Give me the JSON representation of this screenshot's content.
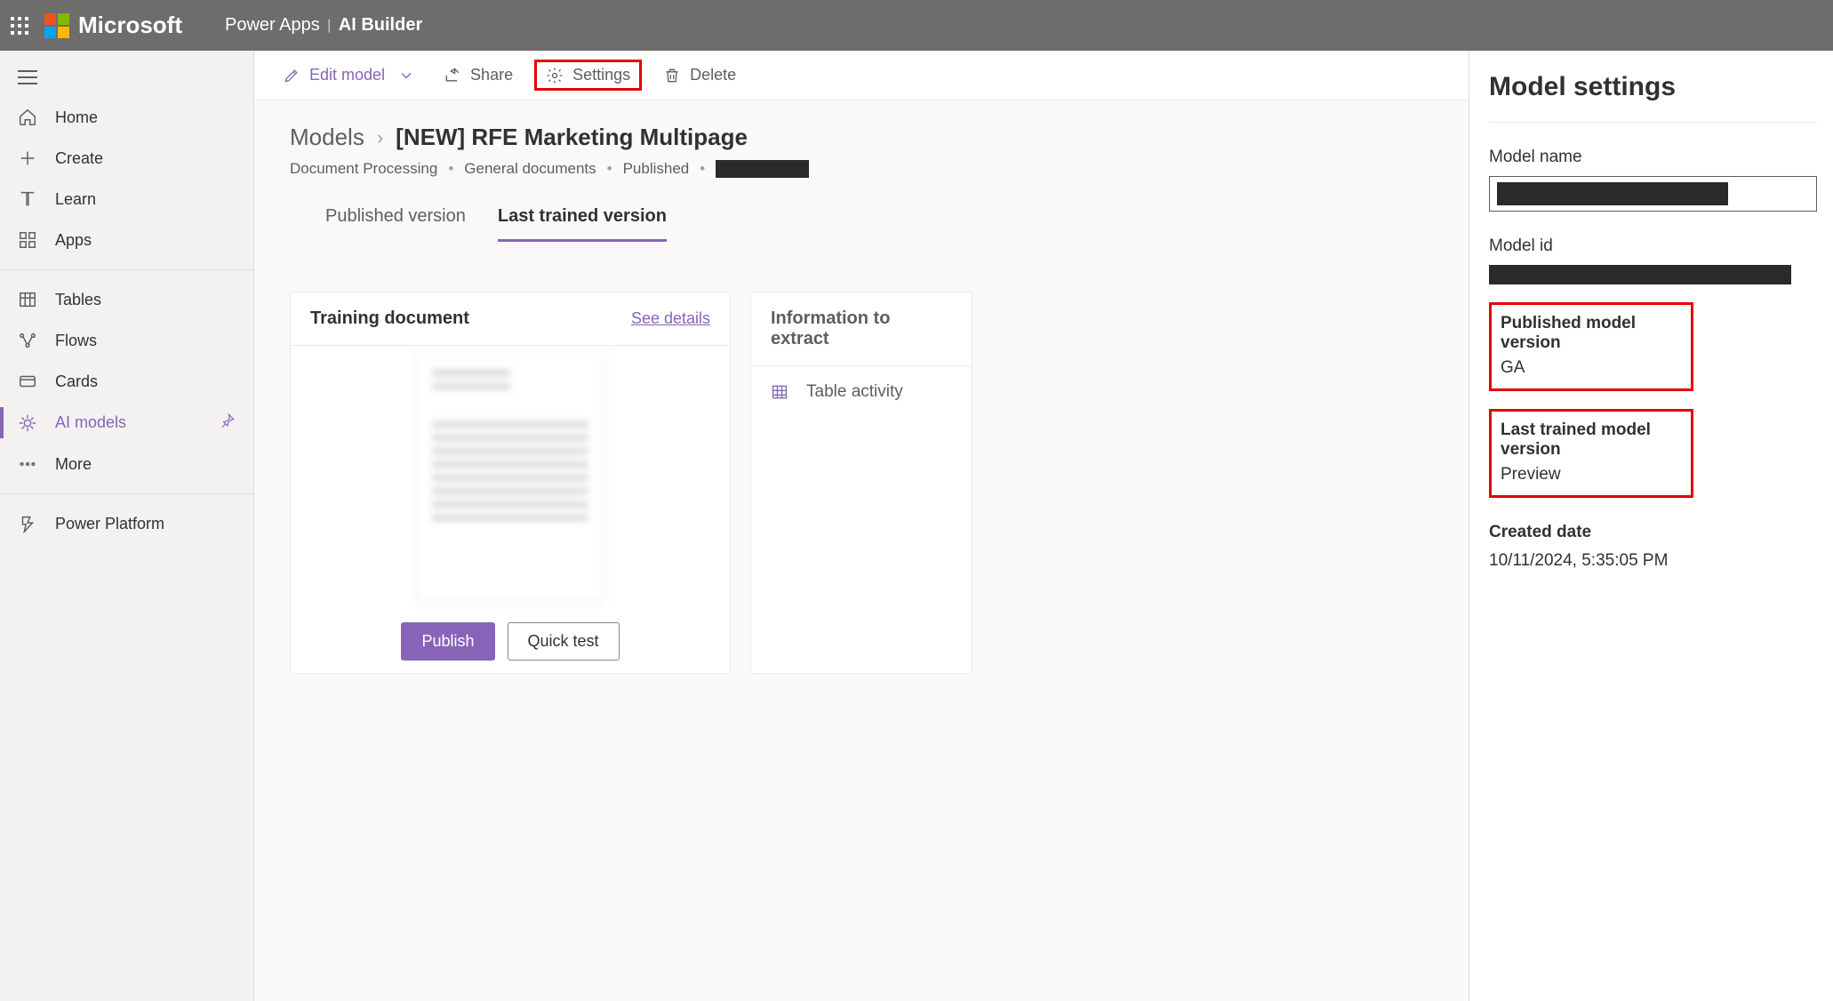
{
  "topbar": {
    "brand": "Microsoft",
    "app": "Power Apps",
    "sub_app": "AI Builder"
  },
  "leftnav": {
    "items": [
      {
        "key": "home",
        "label": "Home"
      },
      {
        "key": "create",
        "label": "Create"
      },
      {
        "key": "learn",
        "label": "Learn"
      },
      {
        "key": "apps",
        "label": "Apps"
      },
      {
        "key": "tables",
        "label": "Tables"
      },
      {
        "key": "flows",
        "label": "Flows"
      },
      {
        "key": "cards",
        "label": "Cards"
      },
      {
        "key": "aimodels",
        "label": "AI models",
        "selected": true
      },
      {
        "key": "more",
        "label": "More"
      },
      {
        "key": "pp",
        "label": "Power Platform"
      }
    ]
  },
  "commandbar": {
    "edit": "Edit model",
    "share": "Share",
    "settings": "Settings",
    "delete": "Delete"
  },
  "breadcrumbs": {
    "root": "Models",
    "current": "[NEW] RFE Marketing Multipage"
  },
  "meta": {
    "type": "Document Processing",
    "subtype": "General documents",
    "status": "Published"
  },
  "tabs": {
    "published": "Published version",
    "trained": "Last trained version",
    "active": "trained"
  },
  "training_card": {
    "title": "Training document",
    "see_details": "See details",
    "publish": "Publish",
    "quick_test": "Quick test"
  },
  "info_card": {
    "title": "Information to extract",
    "row1": "Table activity"
  },
  "settings": {
    "heading": "Model settings",
    "name_label": "Model name",
    "name_value": "",
    "id_label": "Model id",
    "id_value": "",
    "pub_label": "Published model version",
    "pub_value": "GA",
    "trained_label": "Last trained model version",
    "trained_value": "Preview",
    "created_label": "Created date",
    "created_value": "10/11/2024, 5:35:05 PM"
  }
}
